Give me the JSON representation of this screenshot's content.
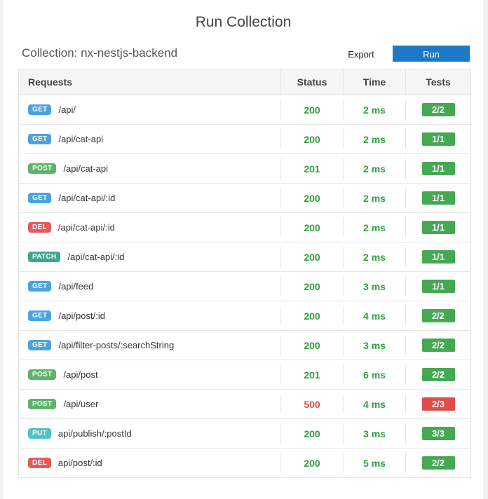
{
  "title": "Run Collection",
  "collection_label": "Collection: nx-nestjs-backend",
  "export_label": "Export",
  "run_label": "Run",
  "columns": {
    "requests": "Requests",
    "status": "Status",
    "time": "Time",
    "tests": "Tests"
  },
  "colors": {
    "GET": "#4aa3df",
    "POST": "#5cb46b",
    "DEL": "#e25b5b",
    "PATCH": "#3ca88f",
    "PUT": "#4ec3c1",
    "ok": "#2f9e3e",
    "error": "#e04b4b",
    "badge_ok": "#45a853",
    "badge_fail": "#e04b4b"
  },
  "rows": [
    {
      "method": "GET",
      "path": "/api/",
      "status": "200",
      "time": "2 ms",
      "tests": "2/2",
      "passed": true
    },
    {
      "method": "GET",
      "path": "/api/cat-api",
      "status": "200",
      "time": "2 ms",
      "tests": "1/1",
      "passed": true
    },
    {
      "method": "POST",
      "path": "/api/cat-api",
      "status": "201",
      "time": "2 ms",
      "tests": "1/1",
      "passed": true
    },
    {
      "method": "GET",
      "path": "/api/cat-api/:id",
      "status": "200",
      "time": "2 ms",
      "tests": "1/1",
      "passed": true
    },
    {
      "method": "DEL",
      "path": "/api/cat-api/:id",
      "status": "200",
      "time": "2 ms",
      "tests": "1/1",
      "passed": true
    },
    {
      "method": "PATCH",
      "path": "/api/cat-api/:id",
      "status": "200",
      "time": "2 ms",
      "tests": "1/1",
      "passed": true
    },
    {
      "method": "GET",
      "path": "/api/feed",
      "status": "200",
      "time": "3 ms",
      "tests": "1/1",
      "passed": true
    },
    {
      "method": "GET",
      "path": "/api/post/:id",
      "status": "200",
      "time": "4 ms",
      "tests": "2/2",
      "passed": true
    },
    {
      "method": "GET",
      "path": "/api/filter-posts/:searchString",
      "status": "200",
      "time": "3 ms",
      "tests": "2/2",
      "passed": true
    },
    {
      "method": "POST",
      "path": "/api/post",
      "status": "201",
      "time": "6 ms",
      "tests": "2/2",
      "passed": true
    },
    {
      "method": "POST",
      "path": "/api/user",
      "status": "500",
      "time": "4 ms",
      "tests": "2/3",
      "passed": false
    },
    {
      "method": "PUT",
      "path": "api/publish/:postId",
      "status": "200",
      "time": "3 ms",
      "tests": "3/3",
      "passed": true
    },
    {
      "method": "DEL",
      "path": "api/post/:id",
      "status": "200",
      "time": "5 ms",
      "tests": "2/2",
      "passed": true
    }
  ]
}
